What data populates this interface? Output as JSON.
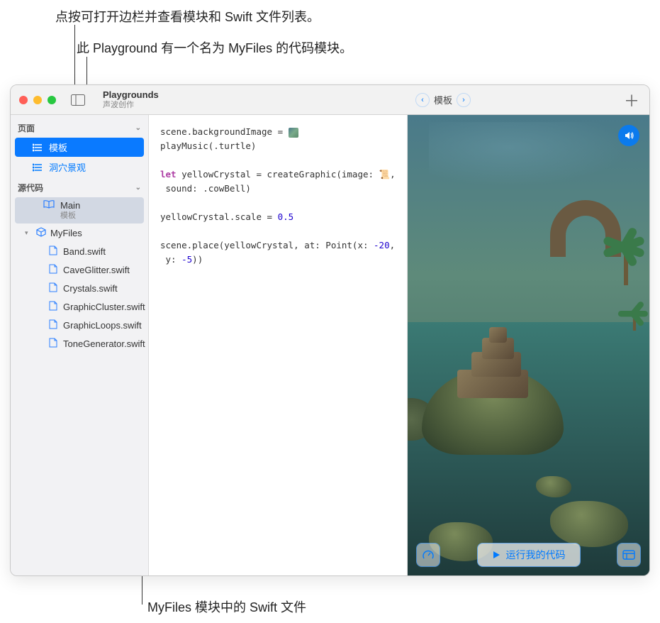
{
  "annotations": {
    "a1": "点按可打开边栏并查看模块和 Swift 文件列表。",
    "a2": "此 Playground 有一个名为 MyFiles 的代码模块。",
    "a3": "MyFiles 模块中的 Swift 文件"
  },
  "titlebar": {
    "nav_title": "Playgrounds",
    "nav_subtitle": "声波创作",
    "breadcrumb_current": "模板"
  },
  "sidebar": {
    "section_pages": "页面",
    "section_source": "源代码",
    "pages": [
      {
        "label": "模板",
        "selected": true
      },
      {
        "label": "洞穴景观",
        "selected": false
      }
    ],
    "main_item": {
      "label": "Main",
      "sublabel": "模板"
    },
    "module": {
      "name": "MyFiles",
      "files": [
        "Band.swift",
        "CaveGlitter.swift",
        "Crystals.swift",
        "GraphicCluster.swift",
        "GraphicLoops.swift",
        "ToneGenerator.swift"
      ]
    }
  },
  "code": {
    "l1a": "scene.backgroundImage = ",
    "l2": "playMusic(.turtle)",
    "l3a": "let",
    "l3b": " yellowCrystal = createGraphic(image: 📜,",
    "l4": " sound: .cowBell)",
    "l5a": "yellowCrystal.scale = ",
    "l5b": "0.5",
    "l6a": "scene.place(yellowCrystal, at: Point(x: ",
    "l6b": "-20",
    "l6c": ",",
    "l7a": " y: ",
    "l7b": "-5",
    "l7c": "))"
  },
  "controls": {
    "run_label": "运行我的代码"
  }
}
